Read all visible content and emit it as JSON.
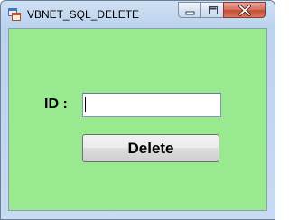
{
  "window": {
    "title": "VBNET_SQL_DELETE",
    "app_icon": "form-app-icon",
    "controls": [
      "minimize-icon",
      "maximize-icon",
      "close-icon"
    ]
  },
  "form": {
    "background_color": "#98e98f",
    "id_label": "ID :",
    "id_input_value": "",
    "delete_button_label": "Delete"
  }
}
